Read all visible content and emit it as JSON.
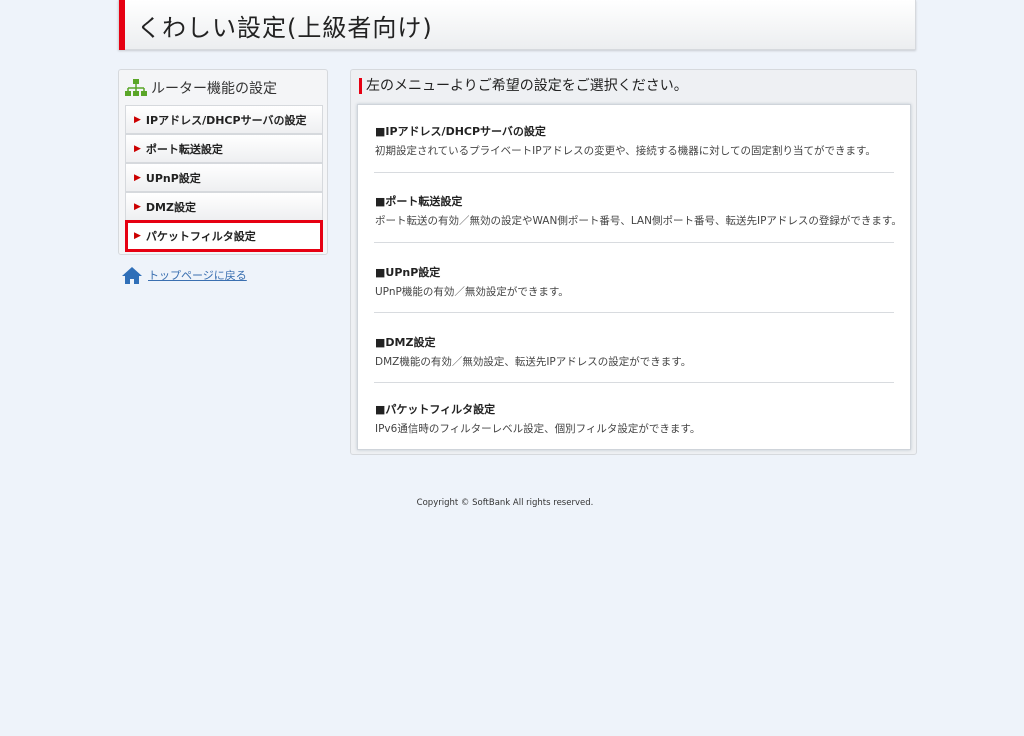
{
  "header": {
    "title": "くわしい設定(上級者向け)"
  },
  "sidebar": {
    "title": "ルーター機能の設定",
    "items": [
      {
        "label": "IPアドレス/DHCPサーバの設定"
      },
      {
        "label": "ポート転送設定"
      },
      {
        "label": "UPnP設定"
      },
      {
        "label": "DMZ設定"
      },
      {
        "label": "パケットフィルタ設定",
        "selected": true
      }
    ],
    "home_link": "トップページに戻る"
  },
  "main": {
    "title": "左のメニューよりご希望の設定をご選択ください。",
    "sections": [
      {
        "heading": "■IPアドレス/DHCPサーバの設定",
        "desc": "初期設定されているプライベートIPアドレスの変更や、接続する機器に対しての固定割り当てができます。"
      },
      {
        "heading": "■ポート転送設定",
        "desc": "ポート転送の有効／無効の設定やWAN側ポート番号、LAN側ポート番号、転送先IPアドレスの登録ができます。"
      },
      {
        "heading": "■UPnP設定",
        "desc": "UPnP機能の有効／無効設定ができます。"
      },
      {
        "heading": "■DMZ設定",
        "desc": "DMZ機能の有効／無効設定、転送先IPアドレスの設定ができます。"
      },
      {
        "heading": "■パケットフィルタ設定",
        "desc": "IPv6通信時のフィルターレベル設定、個別フィルタ設定ができます。"
      }
    ]
  },
  "footer": {
    "copyright": "Copyright © SoftBank All rights reserved."
  },
  "colors": {
    "accent": "#e60012",
    "link": "#3a6fb0"
  }
}
